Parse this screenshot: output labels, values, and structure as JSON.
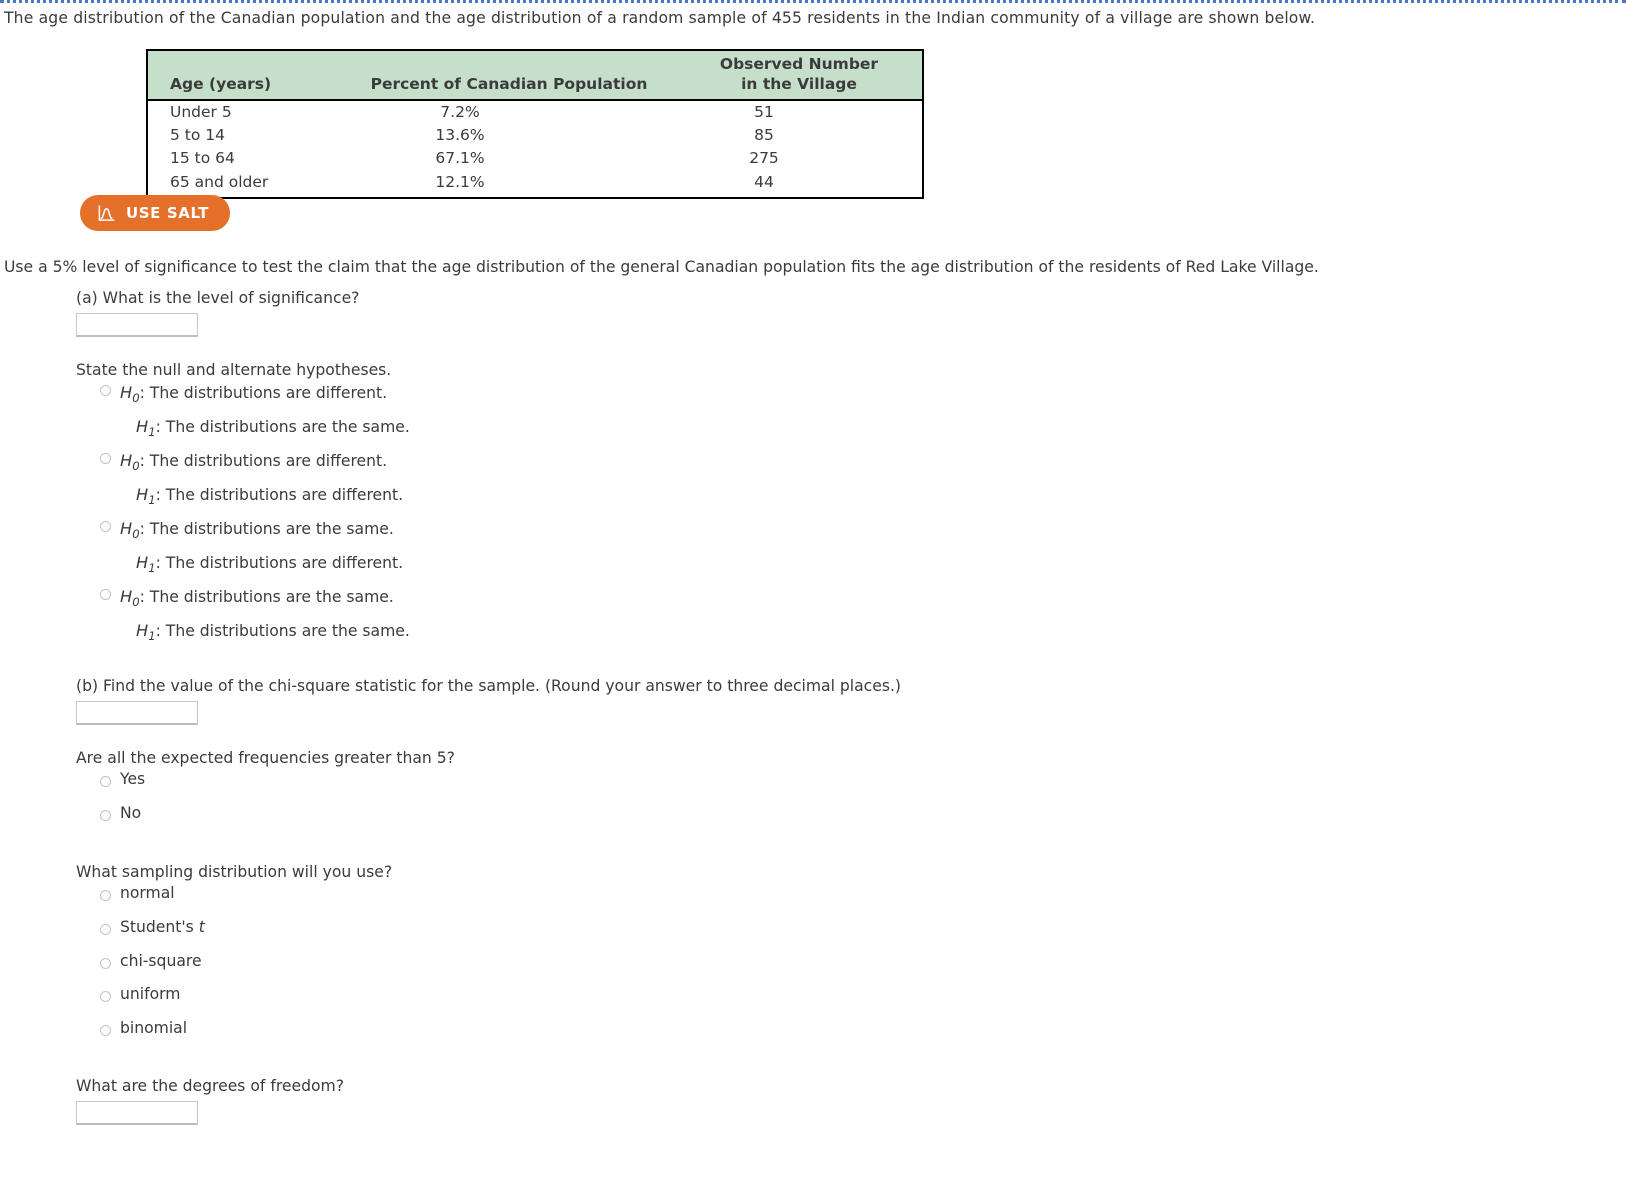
{
  "intro": "The age distribution of the Canadian population and the age distribution of a random sample of 455 residents in the Indian community of a village are shown below.",
  "table": {
    "headers": [
      "Age (years)",
      "Percent of Canadian Population",
      "Observed Number in the Village"
    ],
    "header_observed_line1": "Observed Number",
    "header_observed_line2": "in the Village",
    "rows": [
      {
        "age": "Under 5",
        "percent": "7.2%",
        "observed": "51"
      },
      {
        "age": "5 to 14",
        "percent": "13.6%",
        "observed": "85"
      },
      {
        "age": "15 to 64",
        "percent": "67.1%",
        "observed": "275"
      },
      {
        "age": "65 and older",
        "percent": "12.1%",
        "observed": "44"
      }
    ]
  },
  "salt": {
    "label": "USE SALT",
    "color": "#e4702a",
    "icon": "distribution-curve-icon"
  },
  "claim": "Use a 5% level of significance to test the claim that the age distribution of the general Canadian population fits the age distribution of the residents of Red Lake Village.",
  "part_a": {
    "question": "(a) What is the level of significance?",
    "answer_value": "",
    "hypotheses_prompt": "State the null and alternate hypotheses.",
    "options": [
      {
        "h0": "The distributions are different.",
        "h1": "The distributions are the same."
      },
      {
        "h0": "The distributions are different.",
        "h1": "The distributions are different."
      },
      {
        "h0": "The distributions are the same.",
        "h1": "The distributions are different."
      },
      {
        "h0": "The distributions are the same.",
        "h1": "The distributions are the same."
      }
    ],
    "h0_symbol": "H",
    "h0_sub": "0",
    "h1_symbol": "H",
    "h1_sub": "1",
    "colon": ":"
  },
  "part_b": {
    "question": "(b) Find the value of the chi-square statistic for the sample. (Round your answer to three decimal places.)",
    "answer_value": "",
    "expected_freq_prompt": "Are all the expected frequencies greater than 5?",
    "expected_freq_options": [
      "Yes",
      "No"
    ],
    "sampling_prompt": "What sampling distribution will you use?",
    "sampling_options": [
      "normal",
      "Student's t",
      "chi-square",
      "uniform",
      "binomial"
    ],
    "sampling_option_student_prefix": "Student's ",
    "sampling_option_student_italic": "t",
    "df_prompt": "What are the degrees of freedom?",
    "df_value": ""
  }
}
